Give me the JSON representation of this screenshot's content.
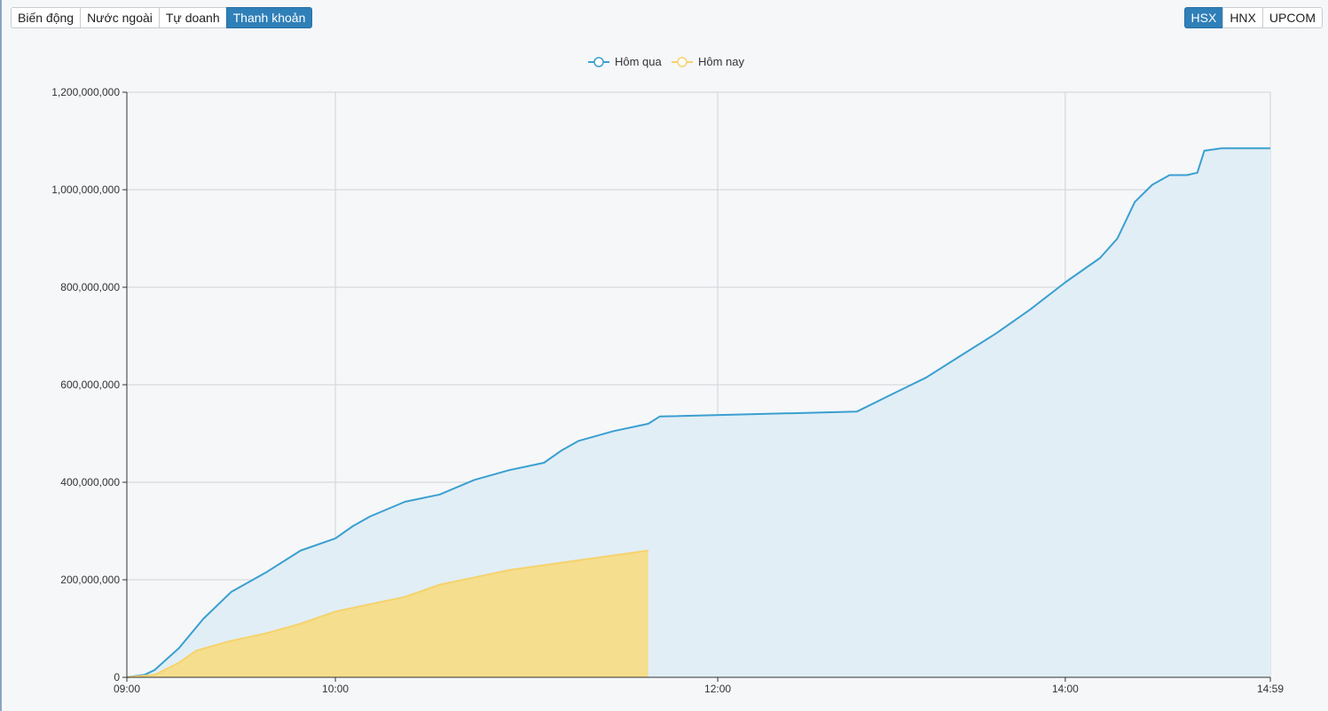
{
  "tabs": {
    "left": [
      {
        "label": "Biến động",
        "active": false
      },
      {
        "label": "Nước ngoài",
        "active": false
      },
      {
        "label": "Tự doanh",
        "active": false
      },
      {
        "label": "Thanh khoản",
        "active": true
      }
    ],
    "right": [
      {
        "label": "HSX",
        "active": true
      },
      {
        "label": "HNX",
        "active": false
      },
      {
        "label": "UPCOM",
        "active": false
      }
    ]
  },
  "colors": {
    "yesterday_line": "#3a9fd0",
    "yesterday_fill": "#e1eef6",
    "today_line": "#f5d36e",
    "today_fill": "#f6dc87",
    "grid": "#cfd3d6",
    "axis": "#333333"
  },
  "chart_data": {
    "type": "area",
    "title": "",
    "xlabel": "",
    "ylabel": "",
    "legend_position": "top-center",
    "grid": true,
    "ylim": [
      0,
      1200000000
    ],
    "y_ticks": [
      "0",
      "200,000,000",
      "400,000,000",
      "600,000,000",
      "800,000,000",
      "1,000,000,000",
      "1,200,000,000"
    ],
    "x_ticks": [
      "09:00",
      "10:00",
      "12:00",
      "14:00",
      "14:59"
    ],
    "series": [
      {
        "name": "Hôm qua",
        "color": "#3a9fd0",
        "points": [
          [
            "09:00",
            0
          ],
          [
            "09:05",
            5000000
          ],
          [
            "09:08",
            15000000
          ],
          [
            "09:15",
            60000000
          ],
          [
            "09:22",
            120000000
          ],
          [
            "09:30",
            175000000
          ],
          [
            "09:40",
            215000000
          ],
          [
            "09:50",
            260000000
          ],
          [
            "10:00",
            285000000
          ],
          [
            "10:05",
            310000000
          ],
          [
            "10:10",
            330000000
          ],
          [
            "10:20",
            360000000
          ],
          [
            "10:30",
            375000000
          ],
          [
            "10:40",
            405000000
          ],
          [
            "10:50",
            425000000
          ],
          [
            "11:00",
            440000000
          ],
          [
            "11:05",
            465000000
          ],
          [
            "11:10",
            485000000
          ],
          [
            "11:15",
            495000000
          ],
          [
            "11:20",
            505000000
          ],
          [
            "11:30",
            520000000
          ],
          [
            "11:35",
            535000000
          ],
          [
            "13:00",
            545000000
          ],
          [
            "13:10",
            580000000
          ],
          [
            "13:20",
            615000000
          ],
          [
            "13:30",
            660000000
          ],
          [
            "13:40",
            705000000
          ],
          [
            "13:50",
            755000000
          ],
          [
            "14:00",
            810000000
          ],
          [
            "14:10",
            860000000
          ],
          [
            "14:15",
            900000000
          ],
          [
            "14:20",
            975000000
          ],
          [
            "14:25",
            1010000000
          ],
          [
            "14:30",
            1030000000
          ],
          [
            "14:35",
            1030000000
          ],
          [
            "14:38",
            1035000000
          ],
          [
            "14:40",
            1080000000
          ],
          [
            "14:45",
            1085000000
          ],
          [
            "14:59",
            1085000000
          ]
        ]
      },
      {
        "name": "Hôm nay",
        "color": "#f5d36e",
        "points": [
          [
            "09:00",
            0
          ],
          [
            "09:08",
            5000000
          ],
          [
            "09:15",
            30000000
          ],
          [
            "09:20",
            55000000
          ],
          [
            "09:30",
            75000000
          ],
          [
            "09:40",
            90000000
          ],
          [
            "09:50",
            110000000
          ],
          [
            "10:00",
            135000000
          ],
          [
            "10:10",
            150000000
          ],
          [
            "10:20",
            165000000
          ],
          [
            "10:30",
            190000000
          ],
          [
            "10:40",
            205000000
          ],
          [
            "10:50",
            220000000
          ],
          [
            "11:00",
            230000000
          ],
          [
            "11:10",
            240000000
          ],
          [
            "11:20",
            250000000
          ],
          [
            "11:30",
            260000000
          ]
        ]
      }
    ]
  }
}
